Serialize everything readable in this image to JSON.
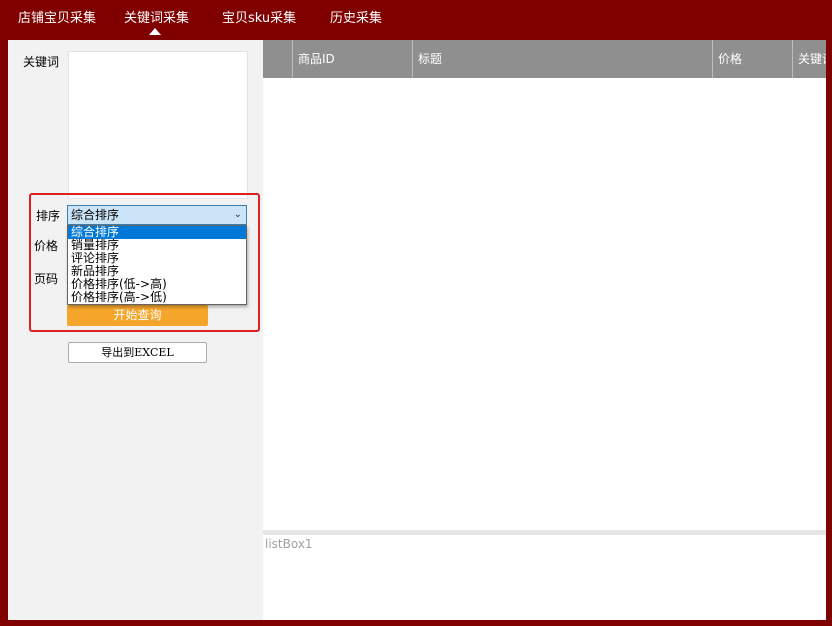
{
  "nav": {
    "tabs": [
      {
        "label": "店铺宝贝采集"
      },
      {
        "label": "关键词采集"
      },
      {
        "label": "宝贝sku采集"
      },
      {
        "label": "历史采集"
      }
    ],
    "active_index": 1
  },
  "form": {
    "keyword_label": "关键词",
    "keyword_value": "",
    "sort_label": "排序",
    "sort_selected": "综合排序",
    "sort_options": [
      "综合排序",
      "销量排序",
      "评论排序",
      "新品排序",
      "价格排序(低->高)",
      "价格排序(高->低)"
    ],
    "price_label": "价格",
    "page_label": "页码",
    "start_button": "开始查询",
    "export_button": "导出到EXCEL"
  },
  "grid": {
    "columns": [
      "",
      "商品ID",
      "标题",
      "价格",
      "关键词"
    ],
    "rows": []
  },
  "listbox": {
    "name": "listBox1"
  },
  "colors": {
    "frame": "#800000",
    "header": "#8f8f8f",
    "start_button": "#f4a52a",
    "highlight_outline": "#e02020",
    "selected_item": "#0078d7"
  }
}
